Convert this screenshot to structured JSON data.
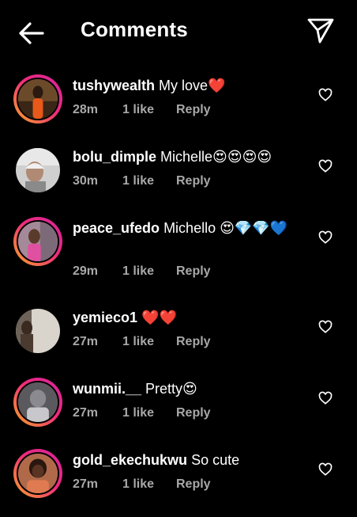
{
  "header": {
    "title": "Comments",
    "back_icon": "arrow-left-icon",
    "share_icon": "paper-plane-icon"
  },
  "comments": [
    {
      "username": "tushywealth",
      "text": "My love❤️",
      "time": "28m",
      "likes": "1 like",
      "reply": "Reply"
    },
    {
      "username": "bolu_dimple",
      "text": "Michelle😍😍😍😍",
      "time": "30m",
      "likes": "1 like",
      "reply": "Reply"
    },
    {
      "username": "peace_ufedo",
      "text": "Michello 😍💎💎💙",
      "time": "29m",
      "likes": "1 like",
      "reply": "Reply"
    },
    {
      "username": "yemieco1",
      "text": "❤️❤️",
      "time": "27m",
      "likes": "1 like",
      "reply": "Reply"
    },
    {
      "username": "wunmii.__",
      "text": "Pretty😍",
      "time": "27m",
      "likes": "1 like",
      "reply": "Reply"
    },
    {
      "username": "gold_ekechukwu",
      "text": "So cute",
      "time": "27m",
      "likes": "1 like",
      "reply": "Reply"
    }
  ]
}
